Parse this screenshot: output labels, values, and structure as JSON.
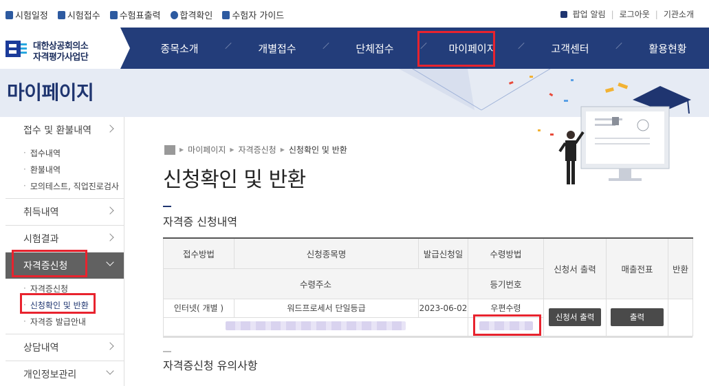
{
  "topbar": {
    "links": [
      {
        "label": "시험일정",
        "icon": "calendar-icon",
        "color": "#2d5aa0"
      },
      {
        "label": "시험접수",
        "icon": "edit-icon",
        "color": "#2d5aa0"
      },
      {
        "label": "수험표출력",
        "icon": "print-icon",
        "color": "#2d5aa0"
      },
      {
        "label": "합격확인",
        "icon": "award-icon",
        "color": "#2d5aa0"
      },
      {
        "label": "수험자 가이드",
        "icon": "book-icon",
        "color": "#2d5aa0"
      }
    ],
    "popup": "팝업 알림",
    "logout": "로그아웃",
    "agency": "기관소개"
  },
  "logo": {
    "line1": "대한상공회의소",
    "line2": "자격평가사업단"
  },
  "nav": {
    "items": [
      "종목소개",
      "개별접수",
      "단체접수",
      "마이페이지",
      "고객센터",
      "활용현황"
    ]
  },
  "banner": {
    "title": "마이페이지"
  },
  "sidebar": {
    "groups": [
      {
        "label": "접수 및 환불내역",
        "subs": [
          "접수내역",
          "환불내역",
          "모의테스트, 직업진로검사"
        ]
      },
      {
        "label": "취득내역"
      },
      {
        "label": "시험결과"
      },
      {
        "label": "자격증신청",
        "subs": [
          "자격증신청",
          "신청확인 및 반환",
          "자격증 발급안내"
        ]
      },
      {
        "label": "상담내역"
      },
      {
        "label": "개인정보관리"
      }
    ]
  },
  "breadcrumb": [
    "마이페이지",
    "자격증신청",
    "신청확인 및 반환"
  ],
  "page": {
    "title": "신청확인 및 반환"
  },
  "section1": {
    "title": "자격증 신청내역"
  },
  "section2": {
    "title": "자격증신청 유의사항"
  },
  "table": {
    "headers": {
      "method": "접수방법",
      "item": "신청종목명",
      "date": "발급신청일",
      "receive": "수령방법",
      "print": "신청서 출력",
      "receipt": "매출전표",
      "return": "반환",
      "address": "수령주소",
      "regno": "등기번호"
    },
    "row": {
      "method": "인터넷( 개별 )",
      "item": "워드프로세서 단일등급",
      "date": "2023-06-02",
      "receive": "우편수령",
      "print_button": "신청서 출력",
      "receipt_button": "출력"
    }
  },
  "colors": {
    "nav": "#233d7a",
    "highlight": "#e8232e",
    "active_side": "#616161"
  }
}
